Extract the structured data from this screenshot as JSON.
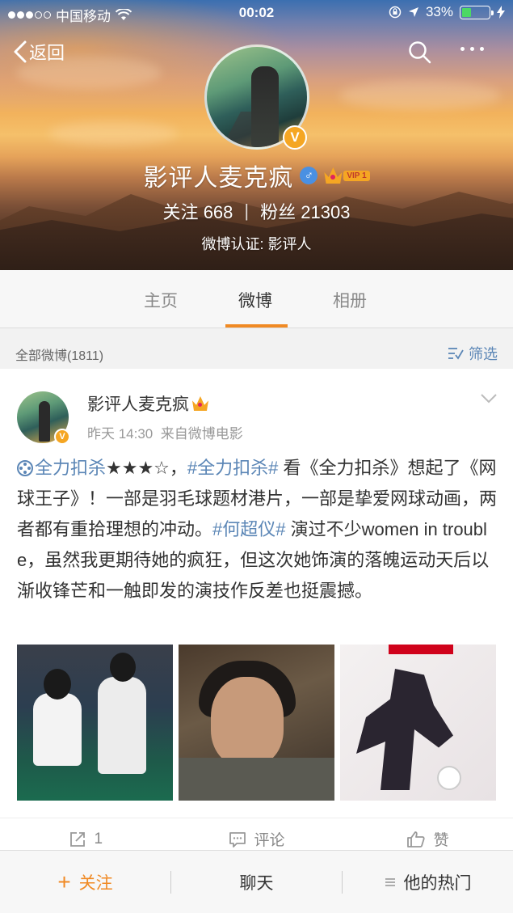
{
  "status_bar": {
    "carrier": "中国移动",
    "time": "00:02",
    "battery_percent": "33%",
    "battery_level": 0.33
  },
  "nav": {
    "back_label": "返回"
  },
  "profile": {
    "name": "影评人麦克疯",
    "vip_label": "VIP 1",
    "follow_label": "关注",
    "follow_count": "668",
    "fans_label": "粉丝",
    "fans_count": "21303",
    "verify_text": "微博认证: 影评人"
  },
  "tabs": [
    {
      "label": "主页",
      "active": false
    },
    {
      "label": "微博",
      "active": true
    },
    {
      "label": "相册",
      "active": false
    }
  ],
  "filter": {
    "all_posts": "全部微博(1811)",
    "filter_label": "筛选"
  },
  "post": {
    "author": "影评人麦克疯",
    "time": "昨天 14:30",
    "source": "来自微博电影",
    "text_parts": {
      "topic1": "全力扣杀",
      "stars": "★★★☆，",
      "topic2": "#全力扣杀#",
      "body1": " 看《全力扣杀》想起了《网球王子》！一部是羽毛球题材港片，一部是挚爱网球动画，两者都有重拾理想的冲动。",
      "topic3": "#何超仪#",
      "body2": " 演过不少women in trouble，虽然我更期待她的疯狂，但这次她饰演的落魄运动天后以渐收锋芒和一触即发的演技作反差也挺震撼。"
    },
    "actions": {
      "repost_count": "1",
      "comment_label": "评论",
      "like_label": "赞"
    }
  },
  "bottom_bar": {
    "follow": "关注",
    "chat": "聊天",
    "hot": "他的热门"
  },
  "colors": {
    "accent": "#f08a24",
    "link": "#5b86b6",
    "vip_gold": "#f5a623",
    "battery_green": "#4cd964"
  }
}
